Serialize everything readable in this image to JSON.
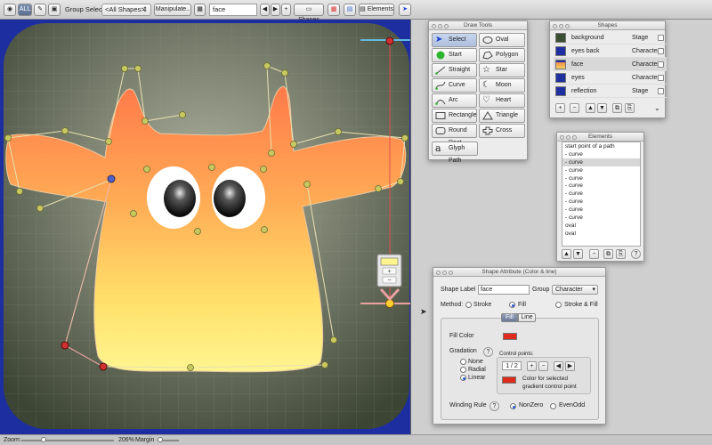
{
  "toolbar": {
    "all_label": "ALL",
    "group_select_label": "Group Select",
    "group_select_value": "<All Shapes>",
    "manipulate_label": "Manipulate..",
    "shape_name_value": "face",
    "shapes_label": "Shapes",
    "elements_label": "Elements"
  },
  "status": {
    "zoom_label": "Zoom:",
    "zoom_value": "206%",
    "margin_label": "Margin"
  },
  "draw_tools": {
    "title": "Draw Tools",
    "tools": [
      "Select",
      "Oval",
      "Start point",
      "Polygon",
      "Straight",
      "Star",
      "Curve",
      "Moon",
      "Arc",
      "Heart",
      "Rectangle",
      "Triangle",
      "Round Rect",
      "Cross",
      "Glyph Path"
    ]
  },
  "shapes": {
    "title": "Shapes",
    "rows": [
      {
        "name": "background",
        "type": "Stage",
        "color": "#3a4f32"
      },
      {
        "name": "eyes back",
        "type": "Character",
        "color": "#1e2fa0"
      },
      {
        "name": "face",
        "type": "Character",
        "color": "#f08a4a"
      },
      {
        "name": "eyes",
        "type": "Character",
        "color": "#1e2fa0"
      },
      {
        "name": "reflection",
        "type": "Stage",
        "color": "#1e2fa0"
      }
    ]
  },
  "elements": {
    "title": "Elements",
    "rows": [
      "start point of a path",
      "- curve",
      "- curve",
      "- curve",
      "- curve",
      "- curve",
      "- curve",
      "- curve",
      "- curve",
      "- curve",
      "oval",
      "oval"
    ]
  },
  "attributes": {
    "title": "Shape Attribute (Color & line)",
    "shape_label_label": "Shape Label",
    "shape_label_value": "face",
    "group_label": "Group",
    "group_value": "Character",
    "method_label": "Method:",
    "method_stroke": "Stroke",
    "method_fill": "Fill",
    "method_stroke_fill": "Stroke & Fill",
    "tab_fill": "Fill",
    "tab_line": "Line",
    "fill_color_label": "Fill Color",
    "gradation_label": "Gradation",
    "grad_none": "None",
    "grad_radial": "Radial",
    "grad_linear": "Linear",
    "control_points_label": "Control points:",
    "control_points_value": "1 / 2",
    "cp_color_text_1": "Color for selected",
    "cp_color_text_2": "gradient control point",
    "winding_rule_label": "Winding Rule",
    "winding_nonzero": "NonZero",
    "winding_evenodd": "EvenOdd"
  },
  "colors": {
    "fill": "#e02a1c",
    "stage_bg": "#1c2ea0",
    "accent": "#2a5bd6"
  }
}
